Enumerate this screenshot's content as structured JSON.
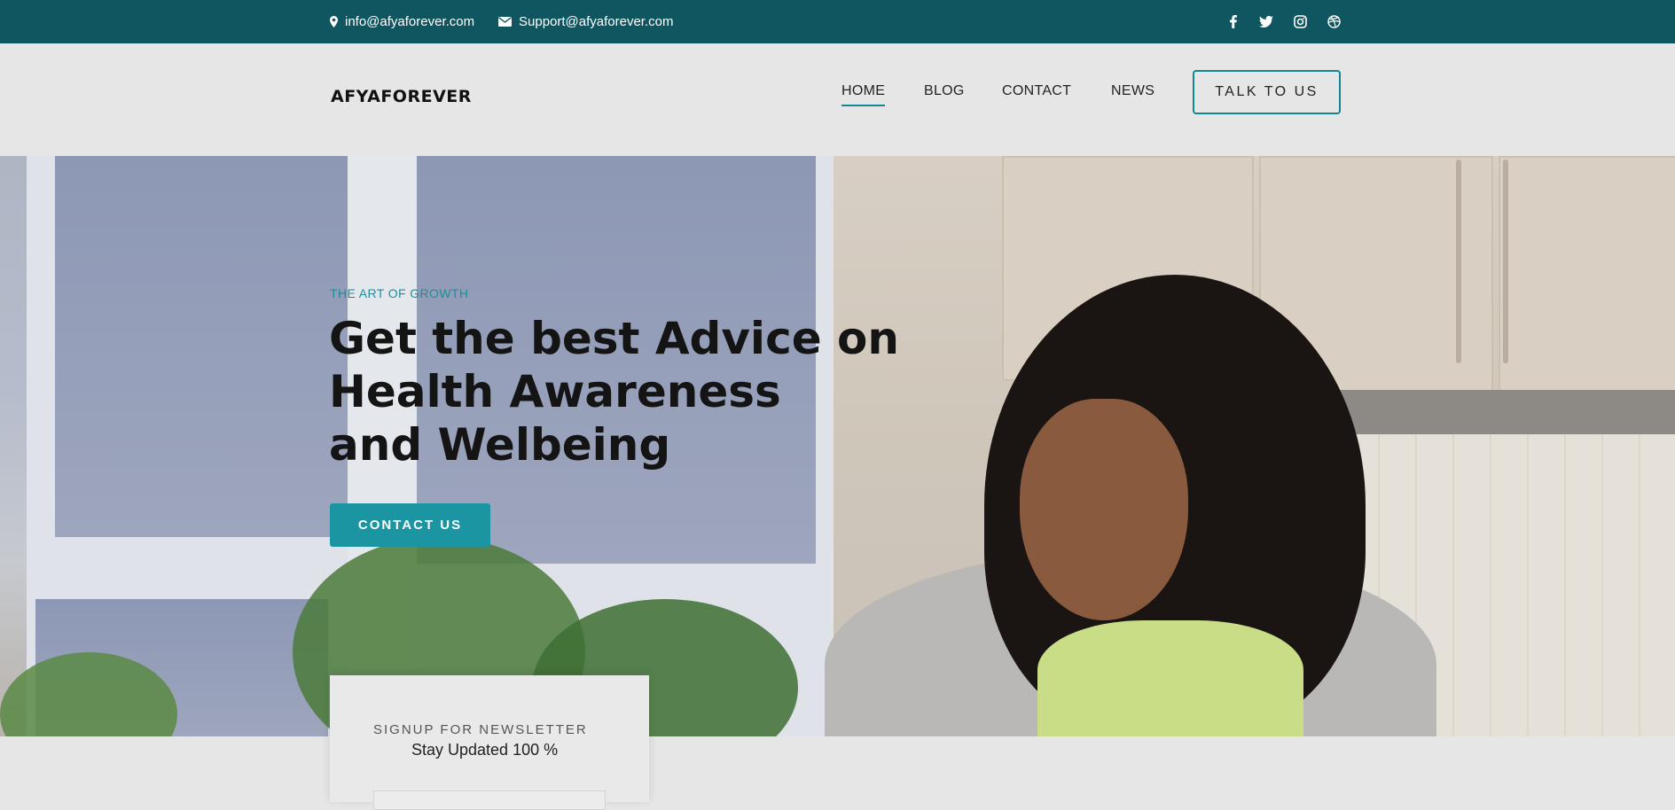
{
  "topbar": {
    "email_info": "info@afyaforever.com",
    "email_support": "Support@afyaforever.com",
    "social_icons": [
      "facebook-icon",
      "twitter-icon",
      "instagram-icon",
      "dribbble-icon"
    ],
    "background": "#0f5660"
  },
  "header": {
    "logo": "AFYAFOREVER",
    "nav": [
      {
        "label": "HOME",
        "active": true
      },
      {
        "label": "BLOG",
        "active": false
      },
      {
        "label": "CONTACT",
        "active": false
      },
      {
        "label": "NEWS",
        "active": false
      }
    ],
    "cta_label": "TALK TO US",
    "accent": "#13878f"
  },
  "hero": {
    "eyebrow": "THE ART OF GROWTH",
    "headline_lines": [
      "Get the best Advice on",
      "Health Awareness",
      "and Welbeing"
    ],
    "button_label": "CONTACT US",
    "button_color": "#1c95a2"
  },
  "newsletter": {
    "title": "SIGNUP FOR NEWSLETTER",
    "subtitle": "Stay Updated 100 %"
  }
}
